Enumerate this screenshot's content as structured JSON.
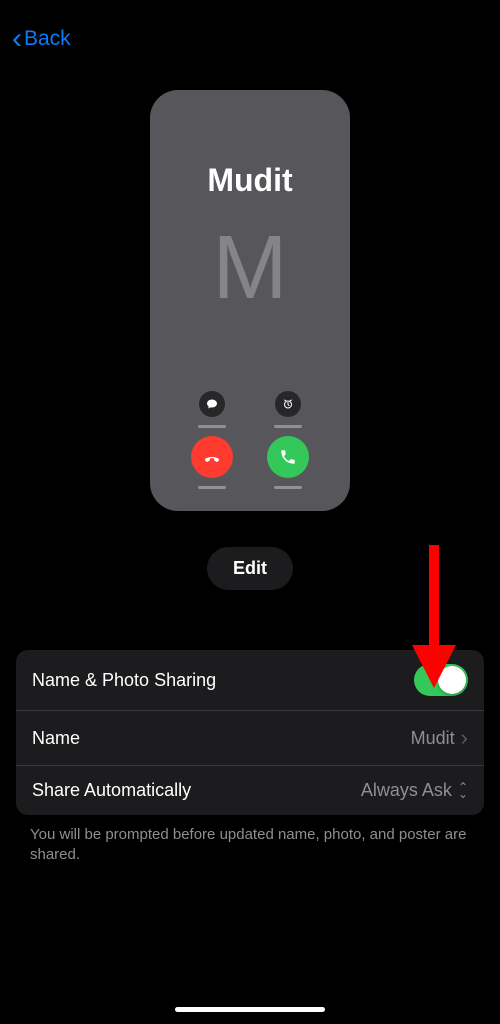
{
  "nav": {
    "back_label": "Back"
  },
  "poster": {
    "name": "Mudit",
    "initial": "M"
  },
  "edit": {
    "label": "Edit"
  },
  "settings": {
    "sharing": {
      "label": "Name & Photo Sharing",
      "enabled": true
    },
    "name": {
      "label": "Name",
      "value": "Mudit"
    },
    "share_auto": {
      "label": "Share Automatically",
      "value": "Always Ask"
    }
  },
  "footer": "You will be prompted before updated name, photo, and poster are shared."
}
